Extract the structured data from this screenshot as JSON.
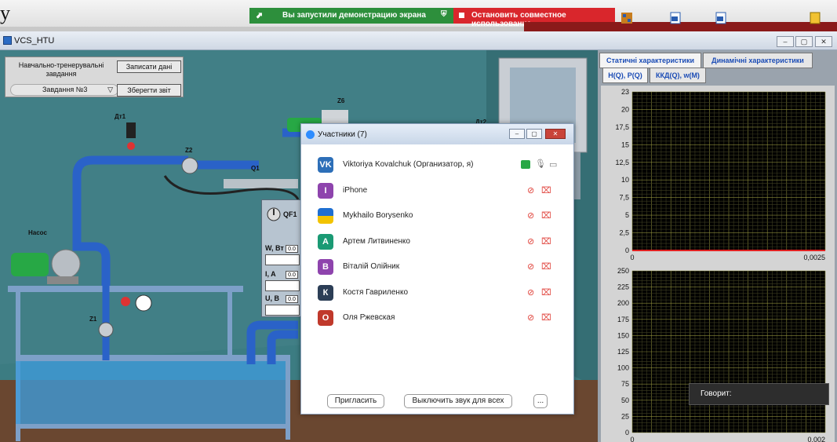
{
  "taskbar": {
    "logo": "у",
    "share_message": "Вы запустили демонстрацию экрана",
    "stop_share_label": "Остановить совместное использование"
  },
  "window": {
    "title": "VCS_HTU",
    "buttons": [
      "–",
      "▢",
      "✕"
    ]
  },
  "task_panel": {
    "title": "Навчально-тренерувальні завдання",
    "record_button": "Записати дані",
    "task_select": "Завдання №3",
    "save_report_button": "Зберегти звіт"
  },
  "scene_labels": {
    "dt1": "Дт1",
    "z2": "Z2",
    "z6": "Z6",
    "q1": "Q1",
    "pump": "Насос",
    "z1": "Z1",
    "qf1": "QF1",
    "dt2": "Дт2"
  },
  "meters": [
    {
      "label": "W, Вт",
      "value": "0.0"
    },
    {
      "label": "I, A",
      "value": "0.0"
    },
    {
      "label": "U, B",
      "value": "0.0"
    }
  ],
  "participants_panel": {
    "title": "Участники (7)",
    "participants": [
      {
        "initials": "VK",
        "name": "Viktoriya Kovalchuk (Организатор, я)",
        "color": "#2d6fb8",
        "muted": false
      },
      {
        "initials": "I",
        "name": "iPhone",
        "color": "#8e44ad",
        "muted": true
      },
      {
        "initials": "",
        "name": "Mykhailo Borysenko",
        "color": "#f2c300",
        "muted": true
      },
      {
        "initials": "А",
        "name": "Артем Литвиненко",
        "color": "#1a9a74",
        "muted": true
      },
      {
        "initials": "В",
        "name": "Віталій Олійник",
        "color": "#8e44ad",
        "muted": true
      },
      {
        "initials": "К",
        "name": "Костя Гавриленко",
        "color": "#2c3e56",
        "muted": true
      },
      {
        "initials": "О",
        "name": "Оля Ржевская",
        "color": "#c0392b",
        "muted": true
      }
    ],
    "invite_button": "Пригласить",
    "mute_all_button": "Выключить звук для всех",
    "more_button": "..."
  },
  "right_panel": {
    "tabs": [
      "Статичні характеристики",
      "Динамічні характеристики"
    ],
    "subtabs": [
      "H(Q), P(Q)",
      "ККД(Q), w(M)"
    ],
    "chart_data": [
      {
        "type": "line",
        "title": "",
        "xlabel": "",
        "ylabel": "",
        "xlim": [
          0,
          0.0025
        ],
        "ylim": [
          0,
          23
        ],
        "yticks": [
          "23",
          "20",
          "17,5",
          "15",
          "12,5",
          "10",
          "7,5",
          "5",
          "2,5",
          "0"
        ],
        "xticks": [
          "0",
          "0,0025"
        ],
        "series": [],
        "grid": true
      },
      {
        "type": "line",
        "title": "",
        "xlabel": "",
        "ylabel": "",
        "xlim": [
          0,
          0.002
        ],
        "ylim": [
          0,
          250
        ],
        "yticks": [
          "250",
          "225",
          "200",
          "175",
          "150",
          "125",
          "100",
          "75",
          "50",
          "25",
          "0"
        ],
        "xticks": [
          "0",
          "0,002"
        ],
        "series": [],
        "grid": true
      }
    ]
  },
  "speaking_label": "Говорит:"
}
